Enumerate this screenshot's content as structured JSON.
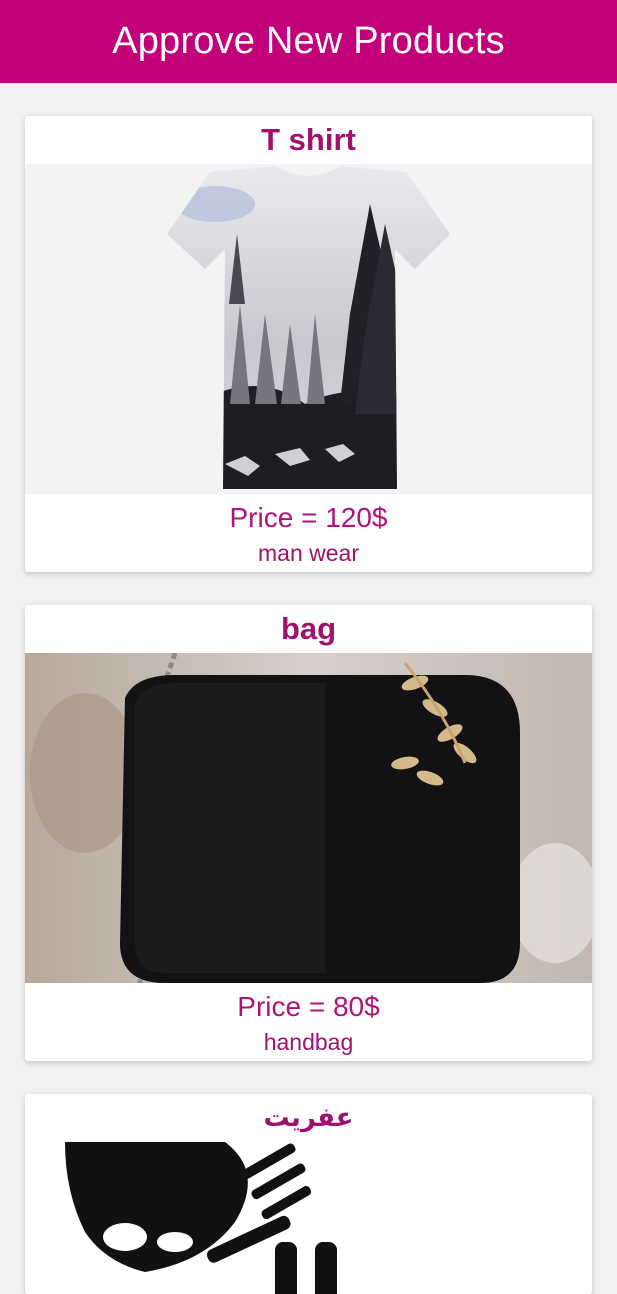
{
  "header": {
    "title": "Approve New Products"
  },
  "colors": {
    "accent": "#c2007a",
    "text_accent": "#a0106d"
  },
  "products": [
    {
      "name": "T shirt",
      "price": "Price = 120$",
      "category": "man wear",
      "image_icon": "tshirt-forest-image"
    },
    {
      "name": "bag",
      "price": "Price = 80$",
      "category": "handbag",
      "image_icon": "black-handbag-image"
    },
    {
      "name": "عفريت",
      "image_icon": "skeleton-hand-image"
    }
  ]
}
